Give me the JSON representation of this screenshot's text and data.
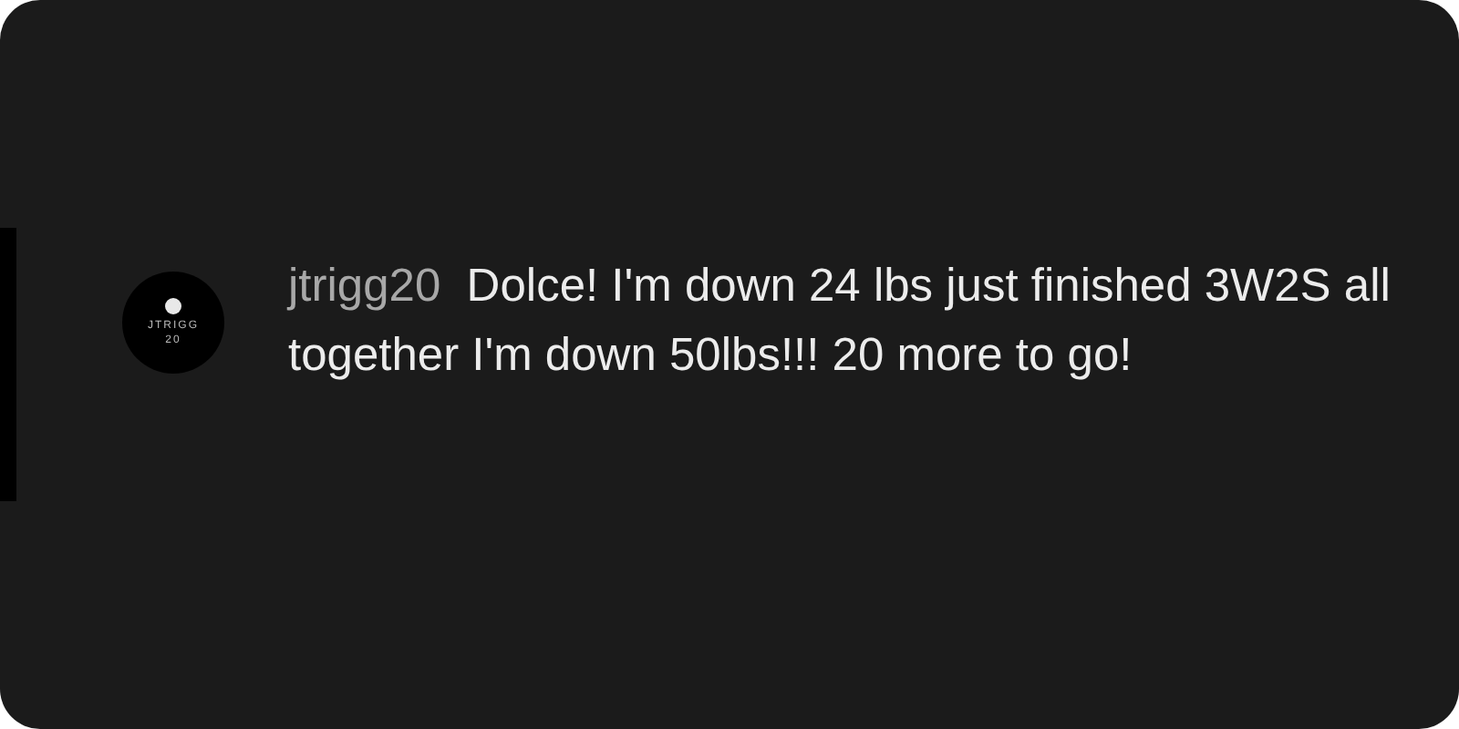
{
  "comment": {
    "avatar": {
      "lines": [
        "JTRIGG",
        "20"
      ]
    },
    "username": "jtrigg20",
    "text": "Dolce! I'm down 24 lbs just finished 3W2S all together I'm down 50lbs!!! 20 more to go!"
  }
}
